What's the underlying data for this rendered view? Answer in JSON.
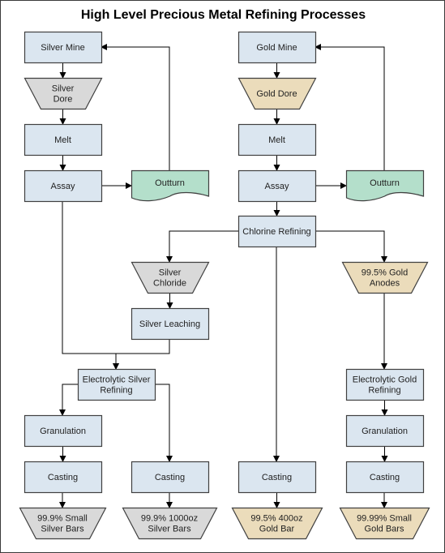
{
  "title": "High Level Precious Metal Refining Processes",
  "colors": {
    "process": "#dbe6f0",
    "silver_product": "#d9d9d9",
    "gold_product": "#ebdcbb",
    "document": "#b4dfcb",
    "stroke": "#404040",
    "line": "#000000"
  },
  "nodes": [
    {
      "id": "silver-mine",
      "type": "process",
      "lines": [
        "Silver Mine"
      ]
    },
    {
      "id": "silver-dore",
      "type": "silver_product",
      "lines": [
        "Silver",
        "Dore"
      ]
    },
    {
      "id": "silver-melt",
      "type": "process",
      "lines": [
        "Melt"
      ]
    },
    {
      "id": "silver-assay",
      "type": "process",
      "lines": [
        "Assay"
      ]
    },
    {
      "id": "silver-outturn",
      "type": "document",
      "lines": [
        "Outturn"
      ]
    },
    {
      "id": "gold-mine",
      "type": "process",
      "lines": [
        "Gold Mine"
      ]
    },
    {
      "id": "gold-dore",
      "type": "gold_product",
      "lines": [
        "Gold Dore"
      ]
    },
    {
      "id": "gold-melt",
      "type": "process",
      "lines": [
        "Melt"
      ]
    },
    {
      "id": "gold-assay",
      "type": "process",
      "lines": [
        "Assay"
      ]
    },
    {
      "id": "gold-outturn",
      "type": "document",
      "lines": [
        "Outturn"
      ]
    },
    {
      "id": "chlorine-refining",
      "type": "process",
      "lines": [
        "Chlorine Refining"
      ]
    },
    {
      "id": "silver-chloride",
      "type": "silver_product",
      "lines": [
        "Silver",
        "Chloride"
      ]
    },
    {
      "id": "silver-leaching",
      "type": "process",
      "lines": [
        "Silver Leaching"
      ]
    },
    {
      "id": "gold-anodes",
      "type": "gold_product",
      "lines": [
        "99.5% Gold",
        "Anodes"
      ]
    },
    {
      "id": "electrolytic-silver-refining",
      "type": "process",
      "lines": [
        "Electrolytic Silver",
        "Refining"
      ]
    },
    {
      "id": "electrolytic-gold-refining",
      "type": "process",
      "lines": [
        "Electrolytic Gold",
        "Refining"
      ]
    },
    {
      "id": "silver-granulation",
      "type": "process",
      "lines": [
        "Granulation"
      ]
    },
    {
      "id": "silver-casting-small",
      "type": "process",
      "lines": [
        "Casting"
      ]
    },
    {
      "id": "silver-casting-1000oz",
      "type": "process",
      "lines": [
        "Casting"
      ]
    },
    {
      "id": "gold-casting-400oz",
      "type": "process",
      "lines": [
        "Casting"
      ]
    },
    {
      "id": "gold-granulation",
      "type": "process",
      "lines": [
        "Granulation"
      ]
    },
    {
      "id": "gold-casting-small",
      "type": "process",
      "lines": [
        "Casting"
      ]
    },
    {
      "id": "silver-small-bars",
      "type": "silver_product",
      "lines": [
        "99.9% Small",
        "Silver Bars"
      ]
    },
    {
      "id": "silver-1000oz-bars",
      "type": "silver_product",
      "lines": [
        "99.9% 1000oz",
        "Silver Bars"
      ]
    },
    {
      "id": "gold-400oz-bar",
      "type": "gold_product",
      "lines": [
        "99.5% 400oz",
        "Gold Bar"
      ]
    },
    {
      "id": "gold-small-bars",
      "type": "gold_product",
      "lines": [
        "99.99% Small",
        "Gold Bars"
      ]
    }
  ],
  "edges": [
    {
      "from": "silver-mine",
      "to": "silver-dore"
    },
    {
      "from": "silver-dore",
      "to": "silver-melt"
    },
    {
      "from": "silver-melt",
      "to": "silver-assay"
    },
    {
      "from": "silver-assay",
      "to": "silver-outturn"
    },
    {
      "from": "silver-outturn",
      "to": "silver-mine"
    },
    {
      "from": "silver-assay",
      "to": "electrolytic-silver-refining"
    },
    {
      "from": "gold-mine",
      "to": "gold-dore"
    },
    {
      "from": "gold-dore",
      "to": "gold-melt"
    },
    {
      "from": "gold-melt",
      "to": "gold-assay"
    },
    {
      "from": "gold-assay",
      "to": "gold-outturn"
    },
    {
      "from": "gold-outturn",
      "to": "gold-mine"
    },
    {
      "from": "gold-assay",
      "to": "chlorine-refining"
    },
    {
      "from": "chlorine-refining",
      "to": "silver-chloride"
    },
    {
      "from": "chlorine-refining",
      "to": "gold-anodes"
    },
    {
      "from": "chlorine-refining",
      "to": "gold-casting-400oz"
    },
    {
      "from": "silver-chloride",
      "to": "silver-leaching"
    },
    {
      "from": "silver-leaching",
      "to": "electrolytic-silver-refining"
    },
    {
      "from": "electrolytic-silver-refining",
      "to": "silver-granulation"
    },
    {
      "from": "electrolytic-silver-refining",
      "to": "silver-casting-1000oz"
    },
    {
      "from": "silver-granulation",
      "to": "silver-casting-small"
    },
    {
      "from": "silver-casting-small",
      "to": "silver-small-bars"
    },
    {
      "from": "silver-casting-1000oz",
      "to": "silver-1000oz-bars"
    },
    {
      "from": "gold-anodes",
      "to": "electrolytic-gold-refining"
    },
    {
      "from": "electrolytic-gold-refining",
      "to": "gold-granulation"
    },
    {
      "from": "gold-granulation",
      "to": "gold-casting-small"
    },
    {
      "from": "gold-casting-small",
      "to": "gold-small-bars"
    },
    {
      "from": "gold-casting-400oz",
      "to": "gold-400oz-bar"
    }
  ]
}
